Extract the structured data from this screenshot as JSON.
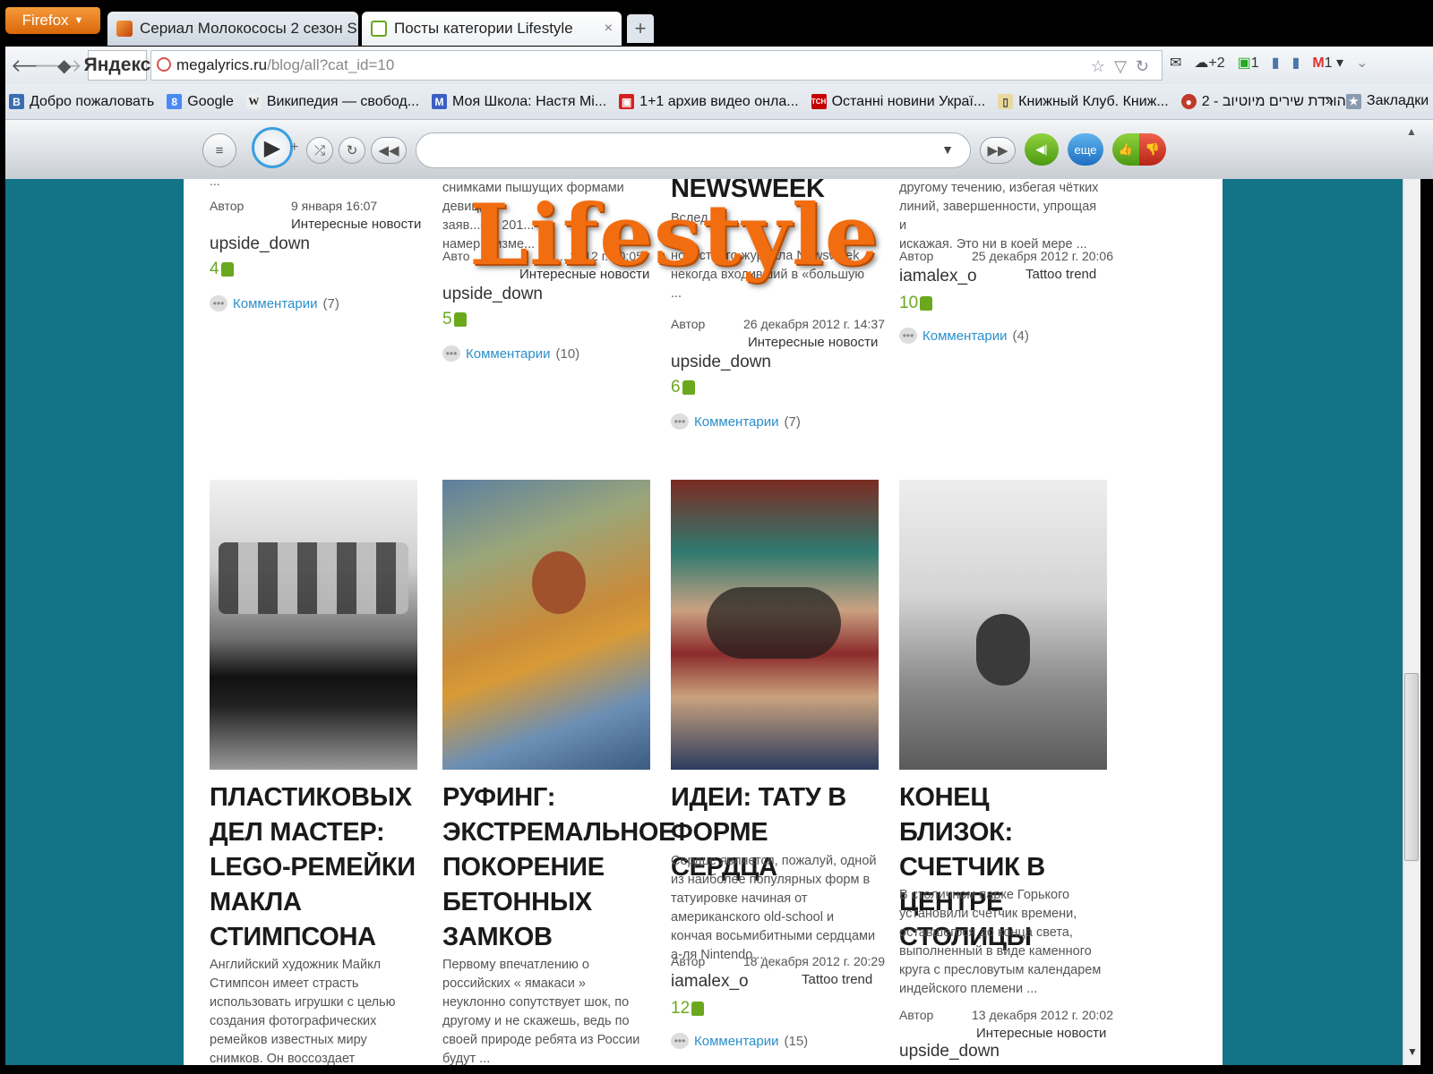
{
  "browser": {
    "firefox_label": "Firefox",
    "tabs": [
      {
        "title": "Сериал Молокососы 2 сезон Skins ...",
        "active": false
      },
      {
        "title": "Посты категории Lifestyle",
        "active": true
      }
    ],
    "new_tab": "+",
    "yandex_logo": "Яндекс",
    "url_host": "megalyrics.ru",
    "url_path": "/blog/all?cat_id=10",
    "toolbar_right": {
      "cloud_badge": "+2",
      "sync_badge": "1",
      "gmail": "M",
      "gmail_count": "1"
    },
    "bookmarks": [
      "Добро пожаловать",
      "Google",
      "Википедия — свобод...",
      "Моя Школа: Настя Mi...",
      "1+1 архив видео онла...",
      "Останні новини Украї...",
      "Книжный Клуб. Книж...",
      "2 - הורדת שירים מיוטיוב..."
    ],
    "bookmarks_more": "»",
    "bookmarks_folder": "Закладки",
    "player_more_label": "еще"
  },
  "overlay_title": "Lifestyle",
  "posts_top": [
    {
      "excerpt_tail": "...",
      "author_label": "Автор",
      "date": "9 января 16:07",
      "category": "Интересные новости",
      "author": "upside_down",
      "likes": "4",
      "comments_label": "Комментарии",
      "comments_count": "(7)"
    },
    {
      "excerpt_lines": [
        "снимками пышущих формами девиц,",
        "заяв...о в 201...",
        "намер... изме..."
      ],
      "author_label": "Авто",
      "date": "...2012 г. 20:05",
      "category": "Интересные новости",
      "author": "upside_down",
      "likes": "5",
      "comments_label": "Комментарии",
      "comments_count": "(10)"
    },
    {
      "title": "NEWSWEEK",
      "excerpt_lines": [
        "Вслед за ... ",
        "...",
        "новостного журнала Newsweek ,",
        "некогда входивший в «большую ..."
      ],
      "author_label": "Автор",
      "date": "26 декабря 2012 г. 14:37",
      "category": "Интересные новости",
      "author": "upside_down",
      "likes": "6",
      "comments_label": "Комментарии",
      "comments_count": "(7)"
    },
    {
      "excerpt_lines": [
        "другому течению, избегая чётких",
        "линий, завершенности, упрощая и",
        "искажая. Это ни в коей мере ..."
      ],
      "author_label": "Автор",
      "date": "25 декабря 2012 г. 20:06",
      "category": "Tattoo trend",
      "author": "iamalex_o",
      "likes": "10",
      "comments_label": "Комментарии",
      "comments_count": "(4)"
    }
  ],
  "posts_bottom": [
    {
      "image": "lego-figures-photo",
      "title": "ПЛАСТИКОВЫХ ДЕЛ МАСТЕР: LEGO-РЕМЕЙКИ МАКЛА СТИМПСОНА",
      "excerpt": "Английский художник Майкл Стимпсон имеет страсть использовать игрушки с целью создания фотографических ремейков известных миру снимков. Он воссоздает знаменитые ..."
    },
    {
      "image": "rooftop-selfie-photo",
      "title": "РУФИНГ: ЭКСТРЕМАЛЬНОЕ ПОКОРЕНИЕ БЕТОННЫХ ЗАМКОВ",
      "excerpt": "Первому впечатлению о российских « ямакаси » неуклонно сопутствует шок, по другому и не скажешь, ведь по своей природе ребята из России будут ..."
    },
    {
      "image": "heart-tattoo-photo",
      "title": "ИДЕИ: ТАТУ В ФОРМЕ СЕРДЦА",
      "excerpt": "Сердце является, пожалуй, одной из наиболее популярных форм в татуировке начиная от американского old-school и кончая восьмибитными сердцами а-ля Nintendo ...",
      "author_label": "Автор",
      "date": "18 декабря 2012 г. 20:29",
      "category": "Tattoo trend",
      "author": "iamalex_o",
      "likes": "12",
      "comments_label": "Комментарии",
      "comments_count": "(15)"
    },
    {
      "image": "gas-mask-photo",
      "title": "КОНЕЦ БЛИЗОК: СЧЕТЧИК В ЦЕНТРЕ СТОЛИЦЫ",
      "excerpt": "В столичном парке Горького установили счетчик времени, оставшегося до конца света, выполненный в виде каменного круга с пресловутым календарем индейского племени ...",
      "author_label": "Автор",
      "date": "13 декабря 2012 г. 20:02",
      "category": "Интересные новости",
      "author": "upside_down"
    }
  ],
  "colors": {
    "page_bg": "#137387",
    "accent_orange": "#f26d10",
    "link_blue": "#2a8fcb",
    "like_green": "#6aa81e"
  }
}
